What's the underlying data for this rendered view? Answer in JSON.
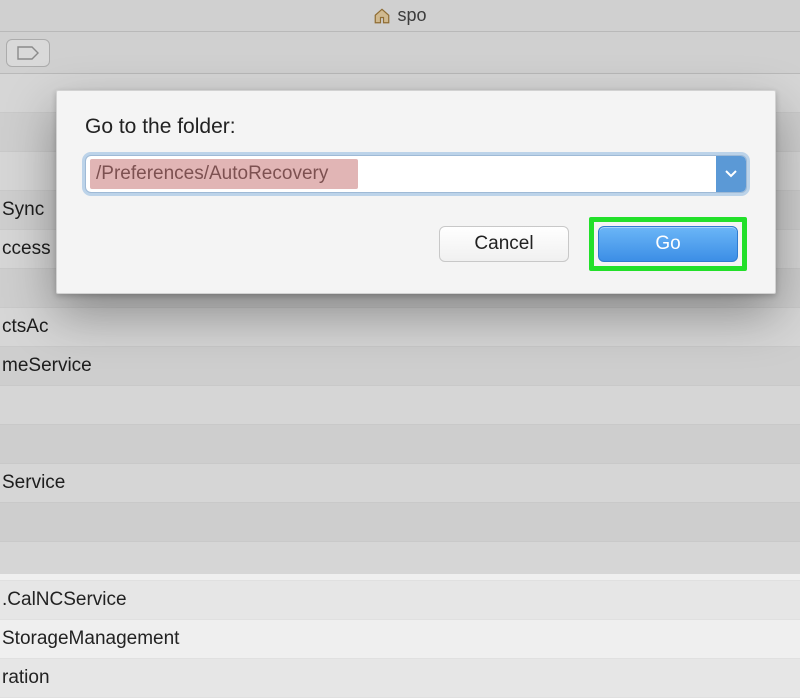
{
  "titlebar": {
    "title": "spo"
  },
  "file_rows": [
    "",
    "",
    "",
    "Sync",
    "ccess",
    "",
    "ctsAc",
    "meService",
    "",
    "",
    "Service",
    "",
    "",
    ".CalNCService",
    "StorageManagement",
    "ration"
  ],
  "dialog": {
    "title": "Go to the folder:",
    "path_value": "/Preferences/AutoRecovery",
    "cancel_label": "Cancel",
    "go_label": "Go"
  }
}
